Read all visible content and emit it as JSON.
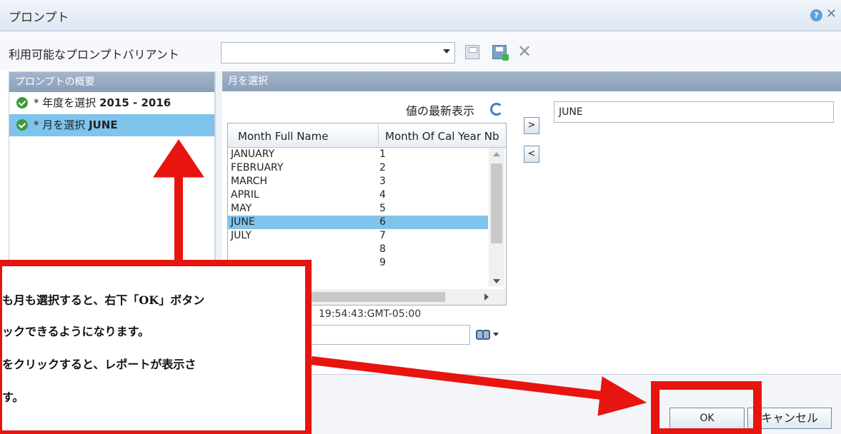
{
  "window": {
    "title": "プロンプト",
    "help_icon": "help-icon",
    "close_icon": "close-icon"
  },
  "variant": {
    "label": "利用可能なプロンプトバリアント",
    "value": ""
  },
  "summary": {
    "header": "プロンプトの概要",
    "items": [
      {
        "prefix": "* 年度を選択",
        "value": "2015 - 2016",
        "selected": false
      },
      {
        "prefix": "* 月を選択",
        "value": "JUNE",
        "selected": true
      }
    ]
  },
  "month_panel": {
    "header": "月を選択",
    "refresh_label": "値の最新表示",
    "selected_value": "JUNE",
    "columns": [
      "Month Full Name",
      "Month Of Cal Year Nb"
    ],
    "rows": [
      [
        "JANUARY",
        "1"
      ],
      [
        "FEBRUARY",
        "2"
      ],
      [
        "MARCH",
        "3"
      ],
      [
        "APRIL",
        "4"
      ],
      [
        "MAY",
        "5"
      ],
      [
        "JUNE",
        "6"
      ],
      [
        "JULY",
        "7"
      ],
      [
        "",
        "8"
      ],
      [
        "",
        "9"
      ]
    ],
    "selected_row": 5,
    "timestamp": "19:54:43:GMT-05:00",
    "move_right": ">",
    "move_left": "<"
  },
  "buttons": {
    "ok": "OK",
    "cancel": "キャンセル"
  },
  "annotation": {
    "lines": [
      "も月も選択すると、右下「OK」ボタン",
      "ックできるようになります。",
      "をクリックすると、レポートが表示さ",
      "す。"
    ],
    "color": "#e8140f"
  }
}
